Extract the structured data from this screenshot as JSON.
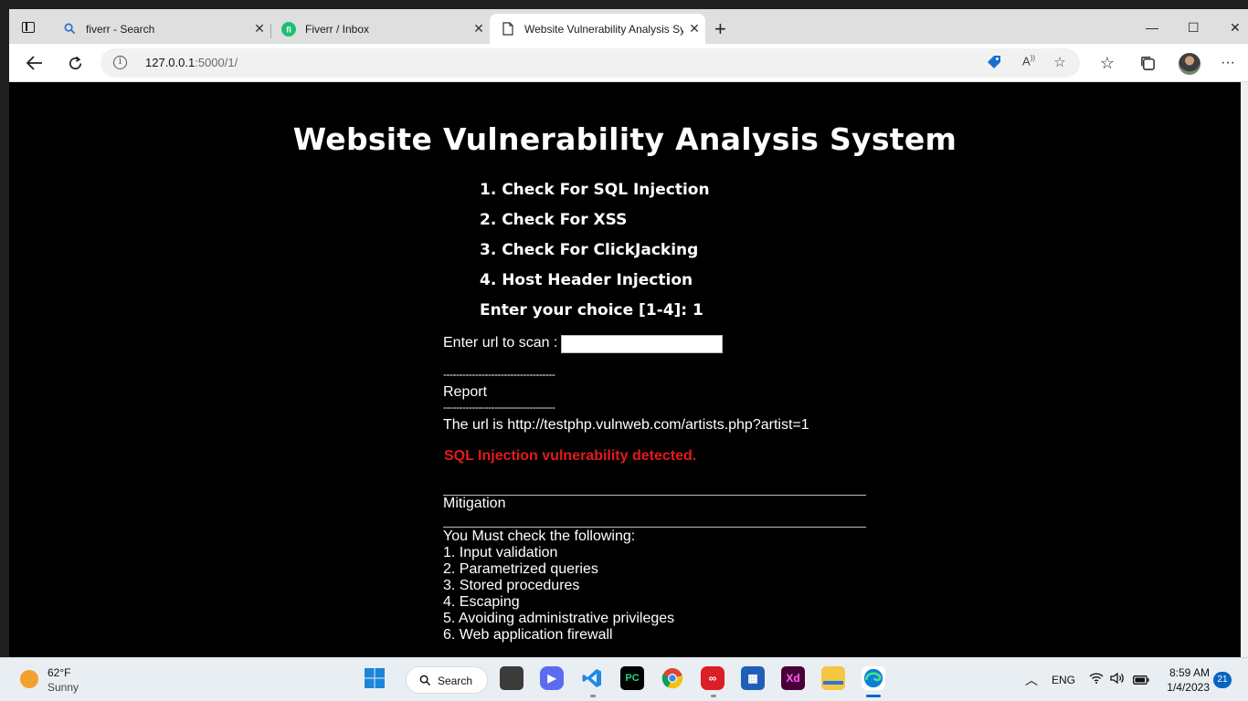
{
  "browser": {
    "tabs": [
      {
        "title": "fiverr - Search",
        "icon": "search-icon"
      },
      {
        "title": "Fiverr / Inbox",
        "icon": "fiverr-icon"
      },
      {
        "title": "Website Vulnerability Analysis System",
        "icon": "page-icon"
      }
    ],
    "new_tab": "+",
    "address": {
      "host": "127.0.0.1",
      "rest": ":5000/1/"
    },
    "window_controls": {
      "minimize": "—",
      "maximize": "☐",
      "close": "✕"
    }
  },
  "page": {
    "title": "Website Vulnerability Analysis System",
    "menu": [
      "1. Check For SQL Injection",
      "2. Check For XSS",
      "3. Check For ClickJacking",
      "4. Host Header Injection"
    ],
    "choice_prompt": "Enter your choice [1-4]: 1",
    "url_label": "Enter url to scan :",
    "url_input_value": "",
    "divider": "-----------------------------------",
    "report_heading": "Report",
    "url_line": "The url is http://testphp.vulnweb.com/artists.php?artist=1",
    "result": "SQL Injection vulnerability detected.",
    "mitigation_heading": "Mitigation",
    "checklist_intro": "You Must check the following:",
    "checklist": [
      "1. Input validation",
      "2. Parametrized queries",
      "3. Stored procedures",
      "4. Escaping",
      "5. Avoiding administrative privileges",
      "6. Web application firewall"
    ]
  },
  "taskbar": {
    "weather": {
      "temp": "62°F",
      "desc": "Sunny"
    },
    "search_label": "Search",
    "apps": [
      "start",
      "search",
      "task-view",
      "zoom",
      "vscode",
      "pycharm",
      "chrome",
      "creative-cloud",
      "store",
      "adobe-xd",
      "file-explorer",
      "edge"
    ],
    "lang": "ENG",
    "time": "8:59 AM",
    "date": "1/4/2023",
    "notifications": "21"
  },
  "colors": {
    "page_bg": "#000000",
    "alert": "#e31b1b",
    "edge_accent": "#0a64c2"
  }
}
